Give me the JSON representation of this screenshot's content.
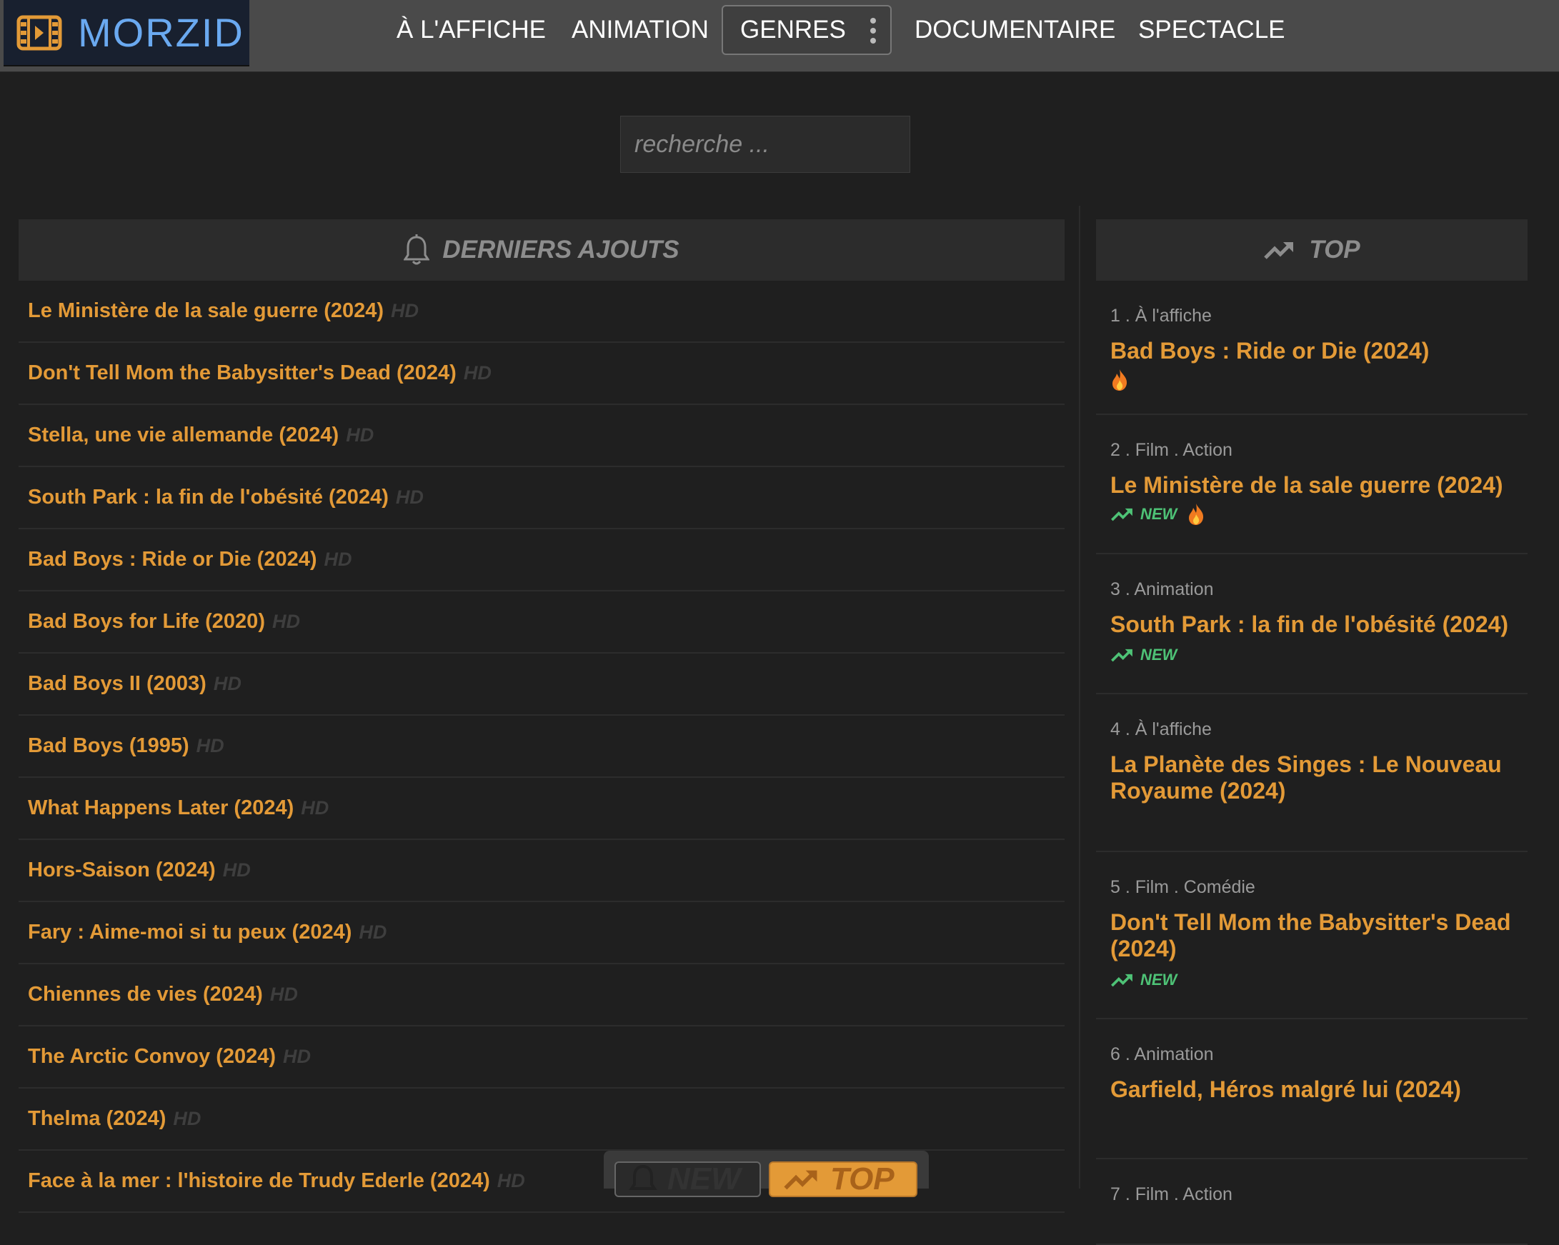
{
  "brand": {
    "name": "MORZID"
  },
  "nav": {
    "items": [
      "À L'AFFICHE",
      "ANIMATION",
      "GENRES",
      "DOCUMENTAIRE",
      "SPECTACLE"
    ]
  },
  "search": {
    "placeholder": "recherche ..."
  },
  "latest": {
    "heading": "DERNIERS AJOUTS",
    "quality": "HD",
    "items": [
      "Le Ministère de la sale guerre (2024)",
      "Don't Tell Mom the Babysitter's Dead (2024)",
      "Stella, une vie allemande (2024)",
      "South Park : la fin de l'obésité (2024)",
      "Bad Boys : Ride or Die (2024)",
      "Bad Boys for Life (2020)",
      "Bad Boys II (2003)",
      "Bad Boys (1995)",
      "What Happens Later (2024)",
      "Hors-Saison (2024)",
      "Fary : Aime-moi si tu peux (2024)",
      "Chiennes de vies (2024)",
      "The Arctic Convoy (2024)",
      "Thelma (2024)",
      "Face à la mer : l'histoire de Trudy Ederle (2024)"
    ]
  },
  "top": {
    "heading": "TOP",
    "new_label": "NEW",
    "items": [
      {
        "category": "1 . À l'affiche",
        "title": "Bad Boys : Ride or Die (2024)",
        "is_new": false,
        "hot": true
      },
      {
        "category": "2 . Film . Action",
        "title": "Le Ministère de la sale guerre (2024)",
        "is_new": true,
        "hot": true
      },
      {
        "category": "3 . Animation",
        "title": "South Park : la fin de l'obésité (2024)",
        "is_new": true,
        "hot": false
      },
      {
        "category": "4 . À l'affiche",
        "title": "La Planète des Singes : Le Nouveau Royaume (2024)",
        "is_new": false,
        "hot": false
      },
      {
        "category": "5 . Film . Comédie",
        "title": "Don't Tell Mom the Babysitter's Dead (2024)",
        "is_new": true,
        "hot": false
      },
      {
        "category": "6 . Animation",
        "title": "Garfield, Héros malgré lui (2024)",
        "is_new": false,
        "hot": false
      },
      {
        "category": "7 . Film . Action",
        "title": "",
        "is_new": false,
        "hot": false
      }
    ]
  },
  "floating": {
    "new_label": "NEW",
    "top_label": "TOP"
  },
  "colors": {
    "accent": "#e39a37",
    "new_green": "#4ec276",
    "logo_blue": "#6aa9f0",
    "background": "#1f1f1f"
  }
}
